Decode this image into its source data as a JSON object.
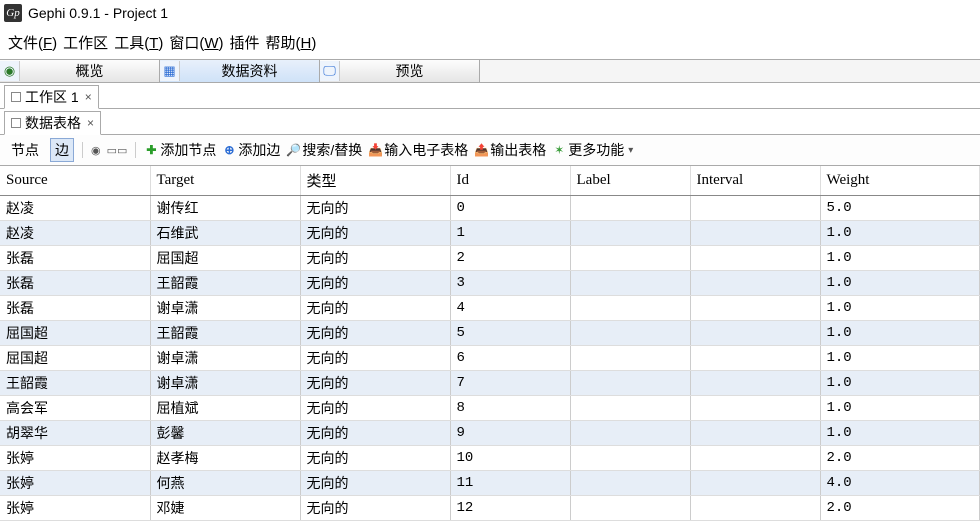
{
  "title": "Gephi 0.9.1 - Project 1",
  "menu": {
    "file": "文件(F)",
    "workspace": "工作区",
    "tools": "工具(T)",
    "window": "窗口(W)",
    "plugins": "插件",
    "help": "帮助(H)"
  },
  "view_tabs": {
    "overview": "概览",
    "data_lab": "数据资料",
    "preview": "预览"
  },
  "workspace_tab": "工作区 1",
  "panel_tab": "数据表格",
  "toolbar": {
    "nodes": "节点",
    "edges": "边",
    "add_node": "添加节点",
    "add_edge": "添加边",
    "search_replace": "搜索/替换",
    "import_spreadsheet": "输入电子表格",
    "export_table": "输出表格",
    "more": "更多功能"
  },
  "columns": {
    "source": "Source",
    "target": "Target",
    "type": "类型",
    "id": "Id",
    "label": "Label",
    "interval": "Interval",
    "weight": "Weight"
  },
  "type_value": "无向的",
  "rows": [
    {
      "source": "赵凌",
      "target": "谢传红",
      "id": "0",
      "label": "",
      "interval": "",
      "weight": "5.0"
    },
    {
      "source": "赵凌",
      "target": "石维武",
      "id": "1",
      "label": "",
      "interval": "",
      "weight": "1.0"
    },
    {
      "source": "张磊",
      "target": "屈国超",
      "id": "2",
      "label": "",
      "interval": "",
      "weight": "1.0"
    },
    {
      "source": "张磊",
      "target": "王韶霞",
      "id": "3",
      "label": "",
      "interval": "",
      "weight": "1.0"
    },
    {
      "source": "张磊",
      "target": "谢卓潇",
      "id": "4",
      "label": "",
      "interval": "",
      "weight": "1.0"
    },
    {
      "source": "屈国超",
      "target": "王韶霞",
      "id": "5",
      "label": "",
      "interval": "",
      "weight": "1.0"
    },
    {
      "source": "屈国超",
      "target": "谢卓潇",
      "id": "6",
      "label": "",
      "interval": "",
      "weight": "1.0"
    },
    {
      "source": "王韶霞",
      "target": "谢卓潇",
      "id": "7",
      "label": "",
      "interval": "",
      "weight": "1.0"
    },
    {
      "source": "高会军",
      "target": "屈植斌",
      "id": "8",
      "label": "",
      "interval": "",
      "weight": "1.0"
    },
    {
      "source": "胡翠华",
      "target": "彭馨",
      "id": "9",
      "label": "",
      "interval": "",
      "weight": "1.0"
    },
    {
      "source": "张婷",
      "target": "赵孝梅",
      "id": "10",
      "label": "",
      "interval": "",
      "weight": "2.0"
    },
    {
      "source": "张婷",
      "target": "何燕",
      "id": "11",
      "label": "",
      "interval": "",
      "weight": "4.0"
    },
    {
      "source": "张婷",
      "target": "邓婕",
      "id": "12",
      "label": "",
      "interval": "",
      "weight": "2.0"
    }
  ]
}
